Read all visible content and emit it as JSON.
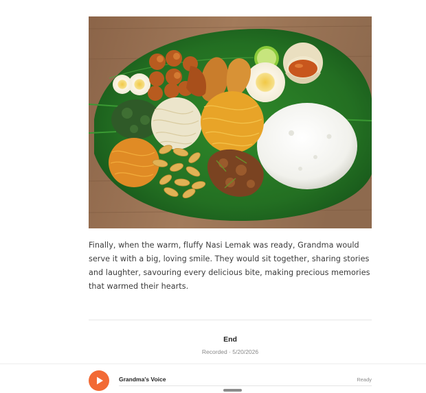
{
  "story": {
    "image_name": "nasi-lemak-plate-image",
    "paragraph": "Finally, when the warm, fluffy Nasi Lemak was ready, Grandma would serve it with a big, loving smile. They would sit together, sharing stories and laughter, savouring every delicious bite, making precious memories that warmed their hearts."
  },
  "footer": {
    "end_label": "End",
    "recorded_label": "Recorded · 5/20/2026"
  },
  "player": {
    "play_icon": "play-icon",
    "track_title": "Grandma's Voice",
    "status": "Ready",
    "progress": 0,
    "accent_color": "#f26a35"
  }
}
